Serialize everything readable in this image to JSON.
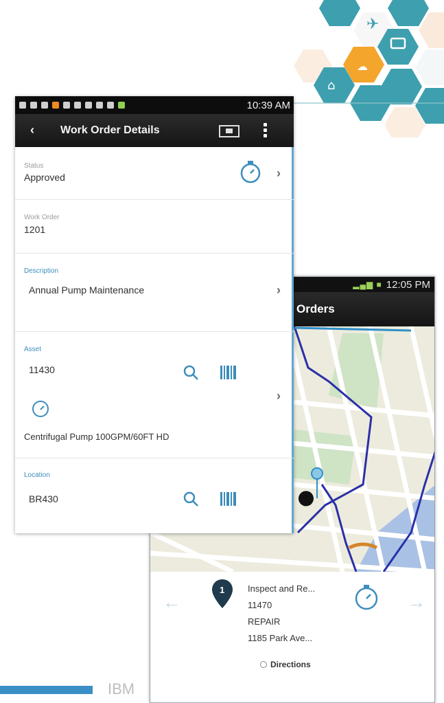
{
  "front_phone": {
    "status_time": "10:39 AM",
    "title": "Work Order Details",
    "status": {
      "label": "Status",
      "value": "Approved"
    },
    "work_order": {
      "label": "Work Order",
      "value": "1201"
    },
    "description": {
      "label": "Description",
      "value": "Annual Pump Maintenance"
    },
    "asset": {
      "label": "Asset",
      "value": "11430",
      "description": "Centrifugal Pump 100GPM/60FT HD"
    },
    "location": {
      "label": "Location",
      "value": "BR430"
    }
  },
  "back_phone": {
    "status_time": "12:05 PM",
    "title": "Orders",
    "card": {
      "pin_number": "1",
      "title": "Inspect and Re...",
      "number": "11470",
      "type": "REPAIR",
      "address": "1185 Park Ave...",
      "directions_label": "Directions"
    }
  },
  "footer": {
    "brand": "IBM"
  },
  "colors": {
    "accent_blue": "#3c8dbb",
    "hex_teal": "#3e9fae",
    "hex_orange": "#f3a52c",
    "route_blue": "#2a2fa8"
  }
}
